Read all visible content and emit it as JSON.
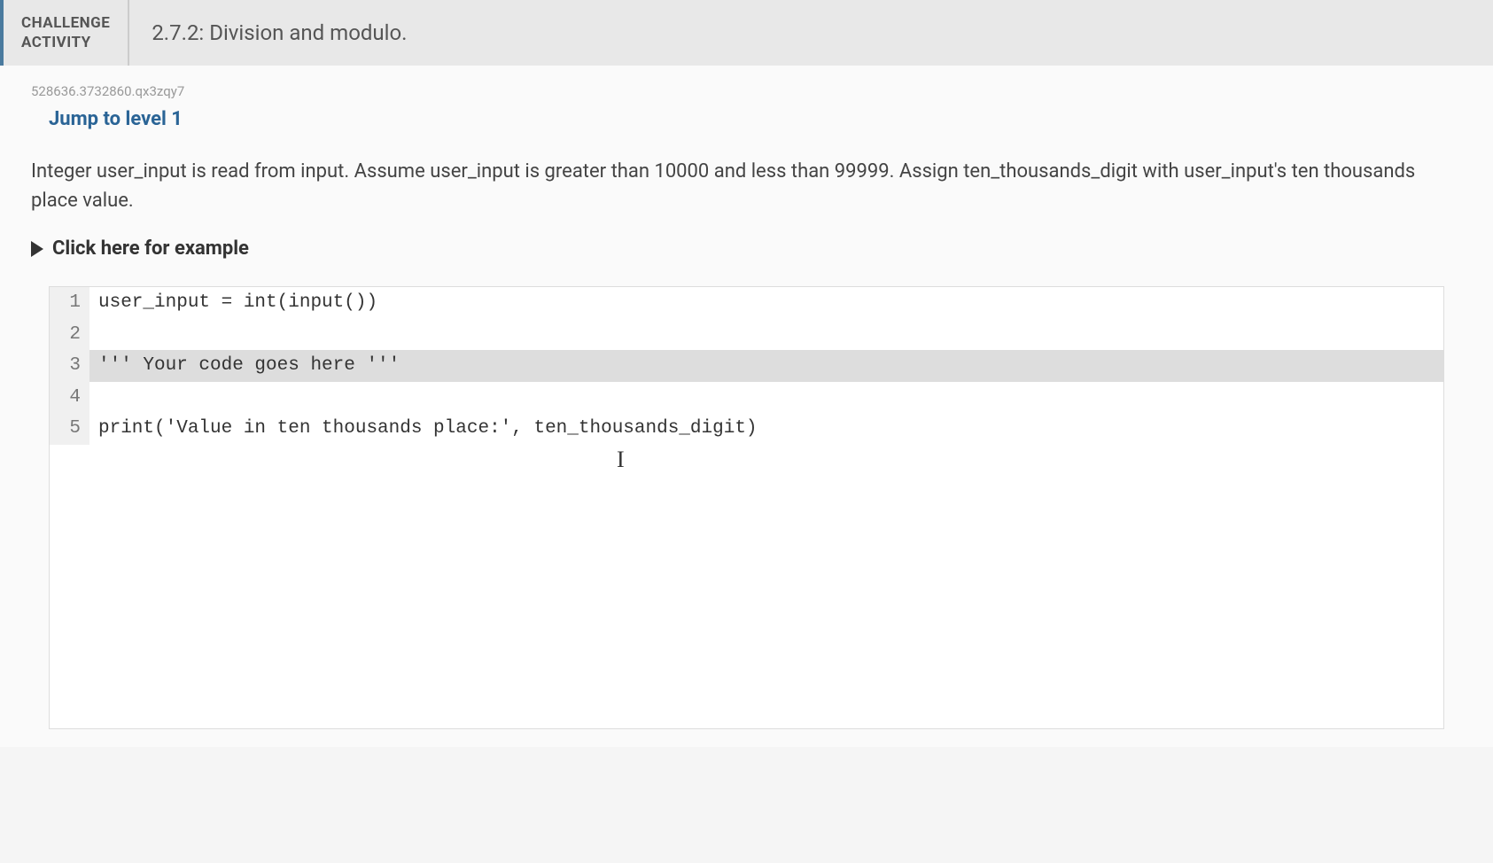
{
  "header": {
    "badge_line1": "CHALLENGE",
    "badge_line2": "ACTIVITY",
    "title": "2.7.2: Division and modulo."
  },
  "content": {
    "id_code": "528636.3732860.qx3zqy7",
    "jump_link": "Jump to level 1",
    "problem_text": "Integer user_input is read from input. Assume user_input is greater than 10000 and less than 99999. Assign ten_thousands_digit with user_input's ten thousands place value.",
    "example_toggle": "Click here for example"
  },
  "code": {
    "lines": [
      {
        "num": "1",
        "text": "user_input = int(input())",
        "highlighted": false
      },
      {
        "num": "2",
        "text": "",
        "highlighted": false
      },
      {
        "num": "3",
        "text": "''' Your code goes here '''",
        "highlighted": true
      },
      {
        "num": "4",
        "text": "",
        "highlighted": false
      },
      {
        "num": "5",
        "text": "print('Value in ten thousands place:', ten_thousands_digit)",
        "highlighted": false
      }
    ]
  }
}
